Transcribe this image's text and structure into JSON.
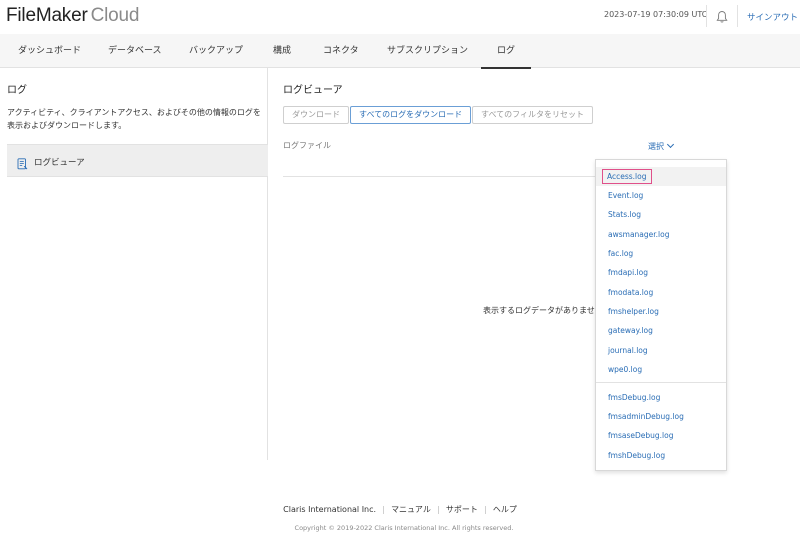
{
  "header": {
    "logo_main": "FileMaker",
    "logo_light": "Cloud",
    "datetime": "2023-07-19 07:30:09 UTC",
    "notification_icon": "bell-icon",
    "signout_label": "サインアウト"
  },
  "nav": {
    "tabs": [
      {
        "label": "ダッシュボード"
      },
      {
        "label": "データベース"
      },
      {
        "label": "バックアップ"
      },
      {
        "label": "構成"
      },
      {
        "label": "コネクタ"
      },
      {
        "label": "サブスクリプション"
      },
      {
        "label": "ログ",
        "active": true
      }
    ]
  },
  "sidebar": {
    "title": "ログ",
    "description": "アクティビティ、クライアントアクセス、およびその他の情報のログを表示およびダウンロードします。",
    "items": [
      {
        "label": "ログビューア",
        "icon": "document-icon",
        "selected": true
      }
    ]
  },
  "main": {
    "title": "ログビューア",
    "buttons": {
      "download": "ダウンロード",
      "download_all": "すべてのログをダウンロード",
      "reset_filters": "すべてのフィルタをリセット"
    },
    "logfile_label": "ログファイル",
    "select_label": "選択",
    "empty_message": "表示するログデータがありません。"
  },
  "dropdown": {
    "items": [
      "Access.log",
      "Event.log",
      "Stats.log",
      "awsmanager.log",
      "fac.log",
      "fmdapi.log",
      "fmodata.log",
      "fmshelper.log",
      "gateway.log",
      "journal.log",
      "wpe0.log"
    ],
    "debug_items": [
      "fmsDebug.log",
      "fmsadminDebug.log",
      "fmsaseDebug.log",
      "fmshDebug.log"
    ]
  },
  "footer": {
    "company": "Claris International Inc.",
    "manual": "マニュアル",
    "support": "サポート",
    "help": "ヘルプ",
    "copyright": "Copyright © 2019-2022 Claris International Inc. All rights reserved."
  },
  "colors": {
    "accent": "#2a6db5",
    "focus_outline": "#e0508a"
  }
}
